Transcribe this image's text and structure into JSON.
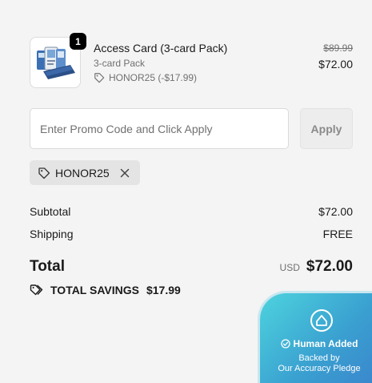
{
  "item": {
    "quantity": "1",
    "name": "Access Card (3-card Pack)",
    "variant": "3-card Pack",
    "discount_code": "HONOR25 (-$17.99)",
    "original_price": "$89.99",
    "price": "$72.00",
    "thumbnail_icon": "access-card-product-image"
  },
  "promo": {
    "placeholder": "Enter Promo Code and Click Apply",
    "value": "",
    "apply_label": "Apply",
    "applied_code": "HONOR25"
  },
  "summary": {
    "subtotal_label": "Subtotal",
    "subtotal_value": "$72.00",
    "shipping_label": "Shipping",
    "shipping_value": "FREE",
    "total_label": "Total",
    "total_currency": "USD",
    "total_value": "$72.00",
    "savings_label": "TOTAL SAVINGS",
    "savings_value": "$17.99"
  },
  "pledge": {
    "title": "Human Added",
    "line1": "Backed by",
    "line2": "Our Accuracy Pledge"
  },
  "colors": {
    "background": "#f4f4f4",
    "pledge_gradient_start": "#4dd3de",
    "pledge_gradient_end": "#3a82cc"
  }
}
